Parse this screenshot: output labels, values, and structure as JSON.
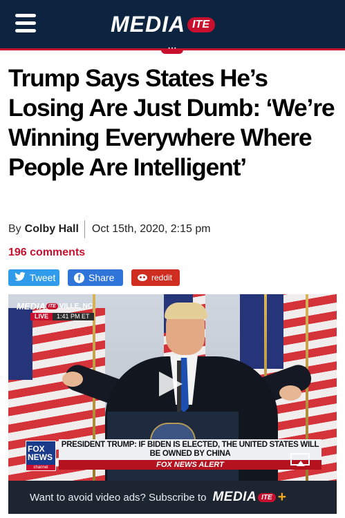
{
  "header": {
    "logo_main": "MEDIA",
    "logo_pill": "ITE"
  },
  "article": {
    "headline": "Trump Says States He’s Losing Are Just Dumb: ‘We’re Winning Everywhere Where People Are Intelligent’",
    "byline_prefix": "By",
    "author": "Colby Hall",
    "date": "Oct 15th, 2020, 2:15 pm",
    "comments": "196 comments"
  },
  "share": {
    "tweet": "Tweet",
    "share": "Share",
    "reddit": "reddit"
  },
  "video": {
    "watermark_main": "MEDIA",
    "watermark_pill": "ITE",
    "location": "VILLE, NC",
    "live": "LIVE",
    "time": "1:41 PM ET",
    "fox_logo": "FOX NEWS",
    "fox_channel": "channel",
    "chyron": "PRESIDENT TRUMP: IF BIDEN IS ELECTED, THE UNITED STATES WILL BE OWNED BY CHINA",
    "alert": "FOX NEWS ALERT",
    "footer_text": "Want to avoid video ads? Subscribe to",
    "footer_logo_main": "MEDIA",
    "footer_logo_pill": "ITE",
    "footer_plus": "+"
  },
  "colors": {
    "header_bg": "#0d2440",
    "accent_red": "#c8102e",
    "tweet_blue": "#2f9bea",
    "facebook_blue": "#2f74d8",
    "reddit_red": "#cf2d20"
  },
  "icons": {
    "menu": "hamburger-icon",
    "tweet": "twitter-bird-icon",
    "share": "facebook-icon",
    "reddit": "reddit-icon",
    "play": "play-icon",
    "airplay": "airplay-icon"
  }
}
